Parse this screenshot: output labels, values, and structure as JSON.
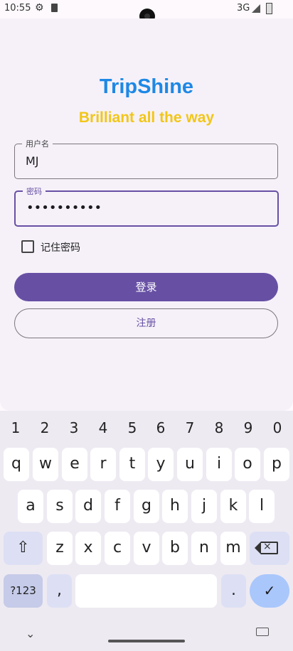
{
  "status_bar": {
    "time": "10:55",
    "network": "3G"
  },
  "app": {
    "brand": "TripShine",
    "slogan": "Brilliant all the way",
    "username_label": "用户名",
    "username_value": "MJ",
    "password_label": "密码",
    "password_value": "••••••••••",
    "remember_label": "记住密码",
    "remember_checked": false,
    "login_label": "登录",
    "register_label": "注册",
    "colors": {
      "brand": "#1e88e5",
      "slogan": "#f2c618",
      "primary": "#6750a4"
    }
  },
  "keyboard": {
    "numbers": [
      "1",
      "2",
      "3",
      "4",
      "5",
      "6",
      "7",
      "8",
      "9",
      "0"
    ],
    "row1": [
      "q",
      "w",
      "e",
      "r",
      "t",
      "y",
      "u",
      "i",
      "o",
      "p"
    ],
    "row2": [
      "a",
      "s",
      "d",
      "f",
      "g",
      "h",
      "j",
      "k",
      "l"
    ],
    "row3": [
      "z",
      "x",
      "c",
      "v",
      "b",
      "n",
      "m"
    ],
    "symbols_label": "?123",
    "comma": ",",
    "period": ".",
    "shift_icon": "shift-icon",
    "backspace_icon": "backspace-icon",
    "enter_icon": "check-icon"
  }
}
